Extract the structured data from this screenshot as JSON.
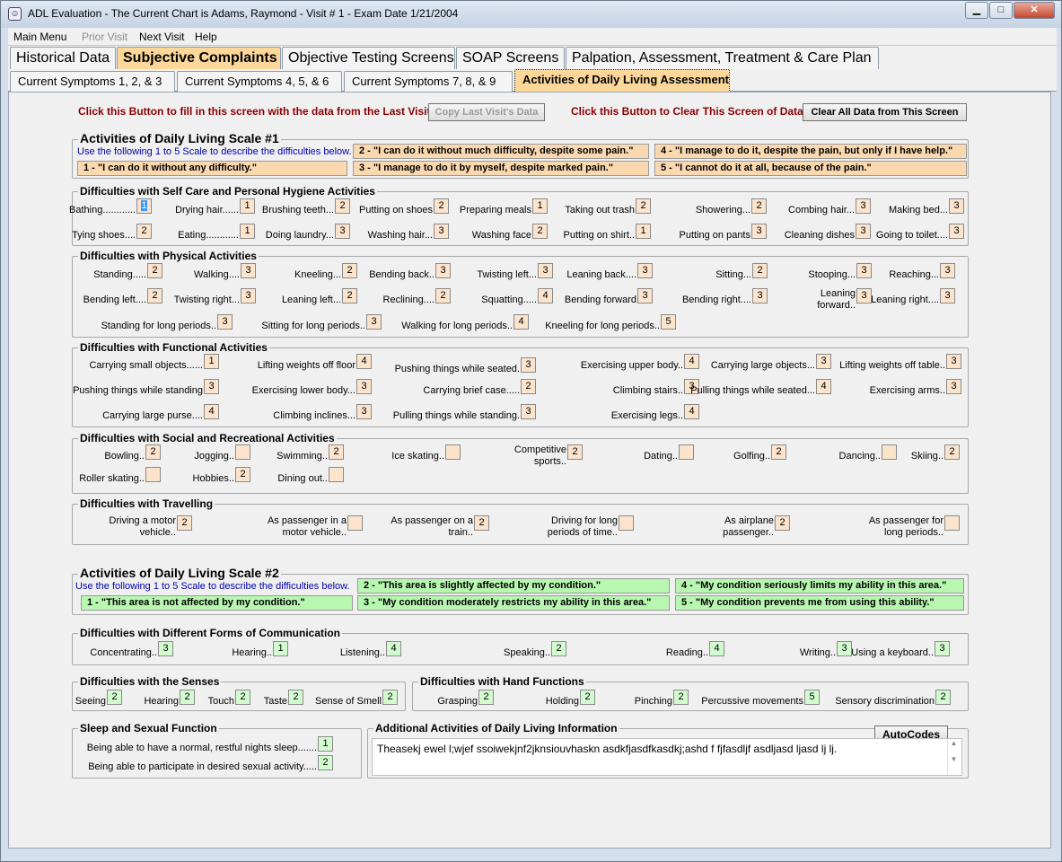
{
  "window": {
    "title": "ADL Evaluation - The Current Chart is Adams, Raymond  - Visit # 1 - Exam Date 1/21/2004",
    "min": "▁",
    "max": "□",
    "close": "✕"
  },
  "menu": {
    "main": "Main Menu",
    "prior": "Prior Visit",
    "next": "Next Visit",
    "help": "Help"
  },
  "tabs_top": [
    "Historical Data",
    "Subjective Complaints",
    "Objective Testing Screens",
    "SOAP Screens",
    "Palpation, Assessment, Treatment & Care Plan"
  ],
  "tabs_sub": [
    "Current Symptoms 1, 2, & 3",
    "Current Symptoms 4, 5, & 6",
    "Current Symptoms 7, 8, & 9",
    "Activities of Daily Living Assessment"
  ],
  "toolbar": {
    "copy_note": "Click this Button to fill in this screen with the data from the Last Visit.",
    "copy_btn": "Copy Last Visit's Data",
    "clear_note": "Click this Button to Clear This Screen of Data.",
    "clear_btn": "Clear All Data from This Screen"
  },
  "scale1": {
    "title": "Activities of Daily Living Scale #1",
    "hint": "Use the following 1 to 5 Scale to describe the difficulties below.",
    "s1": "1 - \"I can do it without any difficulty.\"",
    "s2": "2 - \"I can do it without much difficulty, despite some pain.\"",
    "s3": "3 - \"I manage to do it by myself, despite marked pain.\"",
    "s4": "4 - \"I manage to do it, despite the pain, but only if I have help.\"",
    "s5": "5 - \"I cannot do it at all, because of the pain.\""
  },
  "selfcare": {
    "title": "Difficulties with Self Care and Personal Hygiene Activities",
    "items": [
      {
        "l": "Bathing............",
        "v": "1"
      },
      {
        "l": "Drying hair......",
        "v": "1"
      },
      {
        "l": "Brushing teeth...",
        "v": "2"
      },
      {
        "l": "Putting on shoes",
        "v": "2"
      },
      {
        "l": "Preparing meals",
        "v": "1"
      },
      {
        "l": "Taking out trash",
        "v": "2"
      },
      {
        "l": "Showering...",
        "v": "2"
      },
      {
        "l": "Combing hair...",
        "v": "3"
      },
      {
        "l": "Making bed...",
        "v": "3"
      },
      {
        "l": "Tying shoes....",
        "v": "2"
      },
      {
        "l": "Eating............",
        "v": "1"
      },
      {
        "l": "Doing laundry...",
        "v": "3"
      },
      {
        "l": "Washing hair...",
        "v": "3"
      },
      {
        "l": "Washing face",
        "v": "2"
      },
      {
        "l": "Putting on shirt..",
        "v": "1"
      },
      {
        "l": "Putting on pants",
        "v": "3"
      },
      {
        "l": "Cleaning dishes",
        "v": "3"
      },
      {
        "l": "Going to toilet....",
        "v": "3"
      }
    ]
  },
  "physical": {
    "title": "Difficulties with Physical Activities",
    "items": [
      {
        "l": "Standing.....",
        "v": "2"
      },
      {
        "l": "Walking....",
        "v": "3"
      },
      {
        "l": "Kneeling...",
        "v": "2"
      },
      {
        "l": "Bending back..",
        "v": "3"
      },
      {
        "l": "Twisting left...",
        "v": "3"
      },
      {
        "l": "Leaning back....",
        "v": "3"
      },
      {
        "l": "Sitting...",
        "v": "2"
      },
      {
        "l": "Stooping...",
        "v": "3"
      },
      {
        "l": "Reaching...",
        "v": "3"
      },
      {
        "l": "Bending left....",
        "v": "2"
      },
      {
        "l": "Twisting right...",
        "v": "3"
      },
      {
        "l": "Leaning left...",
        "v": "2"
      },
      {
        "l": "Reclining....",
        "v": "2"
      },
      {
        "l": "Squatting.....",
        "v": "4"
      },
      {
        "l": "Bending forward",
        "v": "3"
      },
      {
        "l": "Bending right....",
        "v": "3"
      },
      {
        "l": "Leaning\nforward..",
        "v": "3"
      },
      {
        "l": "Leaning right....",
        "v": "3"
      },
      {
        "l": "Standing for long periods..",
        "v": "3"
      },
      {
        "l": "Sitting for long periods..",
        "v": "3"
      },
      {
        "l": "Walking for long periods..",
        "v": "4"
      },
      {
        "l": "Kneeling for long periods..",
        "v": "5"
      }
    ]
  },
  "functional": {
    "title": "Difficulties with Functional Activities",
    "items": [
      {
        "l": "Carrying small objects......",
        "v": "1"
      },
      {
        "l": "Lifting weights off floor",
        "v": "4"
      },
      {
        "l": "Pushing things while seated.",
        "v": "3"
      },
      {
        "l": "Exercising upper body..",
        "v": "4"
      },
      {
        "l": "Carrying large objects...",
        "v": "3"
      },
      {
        "l": "Lifting weights off table..",
        "v": "3"
      },
      {
        "l": "Pushing things while standing",
        "v": "3"
      },
      {
        "l": "Exercising lower body...",
        "v": "3"
      },
      {
        "l": "Carrying brief case.....",
        "v": "2"
      },
      {
        "l": "Climbing stairs..",
        "v": "3"
      },
      {
        "l": "Pulling things while seated...",
        "v": "4"
      },
      {
        "l": "Exercising arms..",
        "v": "3"
      },
      {
        "l": "Carrying large purse....",
        "v": "4"
      },
      {
        "l": "Climbing inclines...",
        "v": "3"
      },
      {
        "l": "Pulling things while standing.",
        "v": "3"
      },
      {
        "l": "Exercising legs..",
        "v": "4"
      }
    ]
  },
  "social": {
    "title": "Difficulties with Social and Recreational Activities",
    "items": [
      {
        "l": "Bowling..",
        "v": "2"
      },
      {
        "l": "Jogging..",
        "v": ""
      },
      {
        "l": "Swimming..",
        "v": "2"
      },
      {
        "l": "Ice skating..",
        "v": ""
      },
      {
        "l": "Competitive\nsports..",
        "v": "2"
      },
      {
        "l": "Dating..",
        "v": ""
      },
      {
        "l": "Golfing..",
        "v": "2"
      },
      {
        "l": "Dancing..",
        "v": ""
      },
      {
        "l": "Skiing..",
        "v": "2"
      },
      {
        "l": "Roller skating..",
        "v": ""
      },
      {
        "l": "Hobbies..",
        "v": "2"
      },
      {
        "l": "Dining out..",
        "v": ""
      }
    ]
  },
  "travel": {
    "title": "Difficulties with Travelling",
    "items": [
      {
        "l": "Driving a motor\nvehicle..",
        "v": "2"
      },
      {
        "l": "As passenger in a\nmotor vehicle..",
        "v": ""
      },
      {
        "l": "As passenger on a\ntrain..",
        "v": "2"
      },
      {
        "l": "Driving for long\nperiods of time..",
        "v": ""
      },
      {
        "l": "As airplane\npassenger..",
        "v": "2"
      },
      {
        "l": "As passenger for\nlong periods..",
        "v": ""
      }
    ]
  },
  "scale2": {
    "title": "Activities of Daily Living Scale #2",
    "hint": "Use the following 1 to 5 Scale to describe the difficulties below.",
    "s1": "1 - \"This area is not affected by my condition.\"",
    "s2": "2 - \"This area is slightly affected by my condition.\"",
    "s3": "3 - \"My condition moderately restricts my ability in this area.\"",
    "s4": "4 - \"My condition seriously limits my ability in this area.\"",
    "s5": "5 - \"My condition prevents me from using this ability.\""
  },
  "communication": {
    "title": "Difficulties with Different Forms of Communication",
    "items": [
      {
        "l": "Concentrating..",
        "v": "3"
      },
      {
        "l": "Hearing..",
        "v": "1"
      },
      {
        "l": "Listening..",
        "v": "4"
      },
      {
        "l": "Speaking..",
        "v": "2"
      },
      {
        "l": "Reading..",
        "v": "4"
      },
      {
        "l": "Writing..",
        "v": "3"
      },
      {
        "l": "Using a keyboard..",
        "v": "3"
      }
    ]
  },
  "senses": {
    "title": "Difficulties with the Senses",
    "items": [
      {
        "l": "Seeing",
        "v": "2"
      },
      {
        "l": "Hearing",
        "v": "2"
      },
      {
        "l": "Touch",
        "v": "2"
      },
      {
        "l": "Taste",
        "v": "2"
      },
      {
        "l": "Sense of Smell",
        "v": "2"
      }
    ]
  },
  "hand": {
    "title": "Difficulties with Hand Functions",
    "items": [
      {
        "l": "Grasping",
        "v": "2"
      },
      {
        "l": "Holding",
        "v": "2"
      },
      {
        "l": "Pinching",
        "v": "2"
      },
      {
        "l": "Percussive movements",
        "v": "5"
      },
      {
        "l": "Sensory discrimination",
        "v": "2"
      }
    ]
  },
  "sleep": {
    "title": "Sleep and Sexual Function",
    "items": [
      {
        "l": "Being able to have a normal, restful nights sleep.......",
        "v": "1"
      },
      {
        "l": "Being able to participate in desired sexual activity.....",
        "v": "2"
      }
    ]
  },
  "additional": {
    "title": "Additional Activities of Daily Living Information",
    "autocodes": "AutoCodes",
    "text": "Theasekj ewel l;wjef ssoiwekjnf2jknsiouvhaskn asdkfjasdfkasdkj;ashd f fjfasdljf asdljasd ljasd lj lj."
  }
}
